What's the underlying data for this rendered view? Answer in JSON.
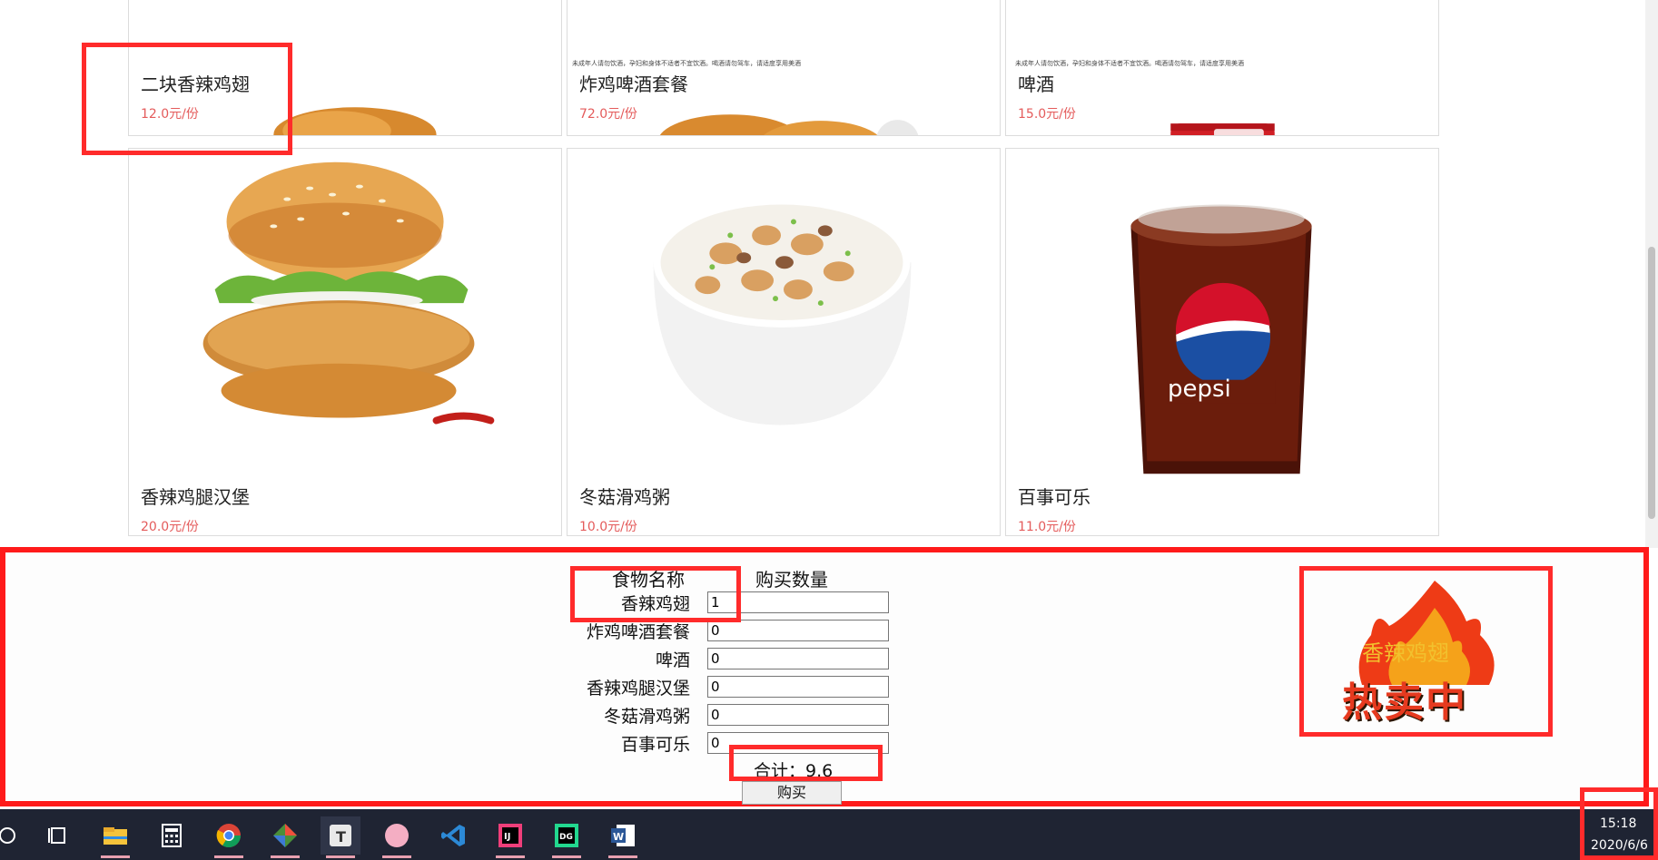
{
  "menu": {
    "items": [
      {
        "name": "二块香辣鸡翅",
        "price": "12.0元/份",
        "image": "spicy-wings",
        "caption": ""
      },
      {
        "name": "炸鸡啤酒套餐",
        "price": "72.0元/份",
        "image": "fried-chicken-beer",
        "caption": "未成年人请勿饮酒，孕妇和身体不适者不宜饮酒。喝酒请勿驾车，请适度享用美酒"
      },
      {
        "name": "啤酒",
        "price": "15.0元/份",
        "image": "beer-can",
        "caption": "未成年人请勿饮酒，孕妇和身体不适者不宜饮酒。喝酒请勿驾车，请适度享用美酒"
      },
      {
        "name": "香辣鸡腿汉堡",
        "price": "20.0元/份",
        "image": "chicken-burger",
        "caption": ""
      },
      {
        "name": "冬菇滑鸡粥",
        "price": "10.0元/份",
        "image": "chicken-congee",
        "caption": ""
      },
      {
        "name": "百事可乐",
        "price": "11.0元/份",
        "image": "pepsi-cup",
        "caption": ""
      }
    ]
  },
  "order": {
    "header_name": "食物名称",
    "header_qty": "购买数量",
    "rows": [
      {
        "name": "香辣鸡翅",
        "qty": "1"
      },
      {
        "name": "炸鸡啤酒套餐",
        "qty": "0"
      },
      {
        "name": "啤酒",
        "qty": "0"
      },
      {
        "name": "香辣鸡腿汉堡",
        "qty": "0"
      },
      {
        "name": "冬菇滑鸡粥",
        "qty": "0"
      },
      {
        "name": "百事可乐",
        "qty": "0"
      }
    ],
    "total": "合计：9.6",
    "buy_label": "购买"
  },
  "promo": {
    "item": "香辣鸡翅",
    "label": "热卖中"
  },
  "taskbar": {
    "apps": [
      "search-icon",
      "task-view-icon",
      "file-explorer-icon",
      "calculator-icon",
      "chrome-icon",
      "git-icon",
      "typora-icon",
      "app-circle-icon",
      "vscode-icon",
      "intellij-icon",
      "datagrip-icon",
      "word-icon"
    ],
    "time": "15:18",
    "date": "2020/6/6"
  },
  "colors": {
    "price": "#e45b5b",
    "highlight": "#ff2b2b",
    "taskbar": "#1f2433"
  }
}
